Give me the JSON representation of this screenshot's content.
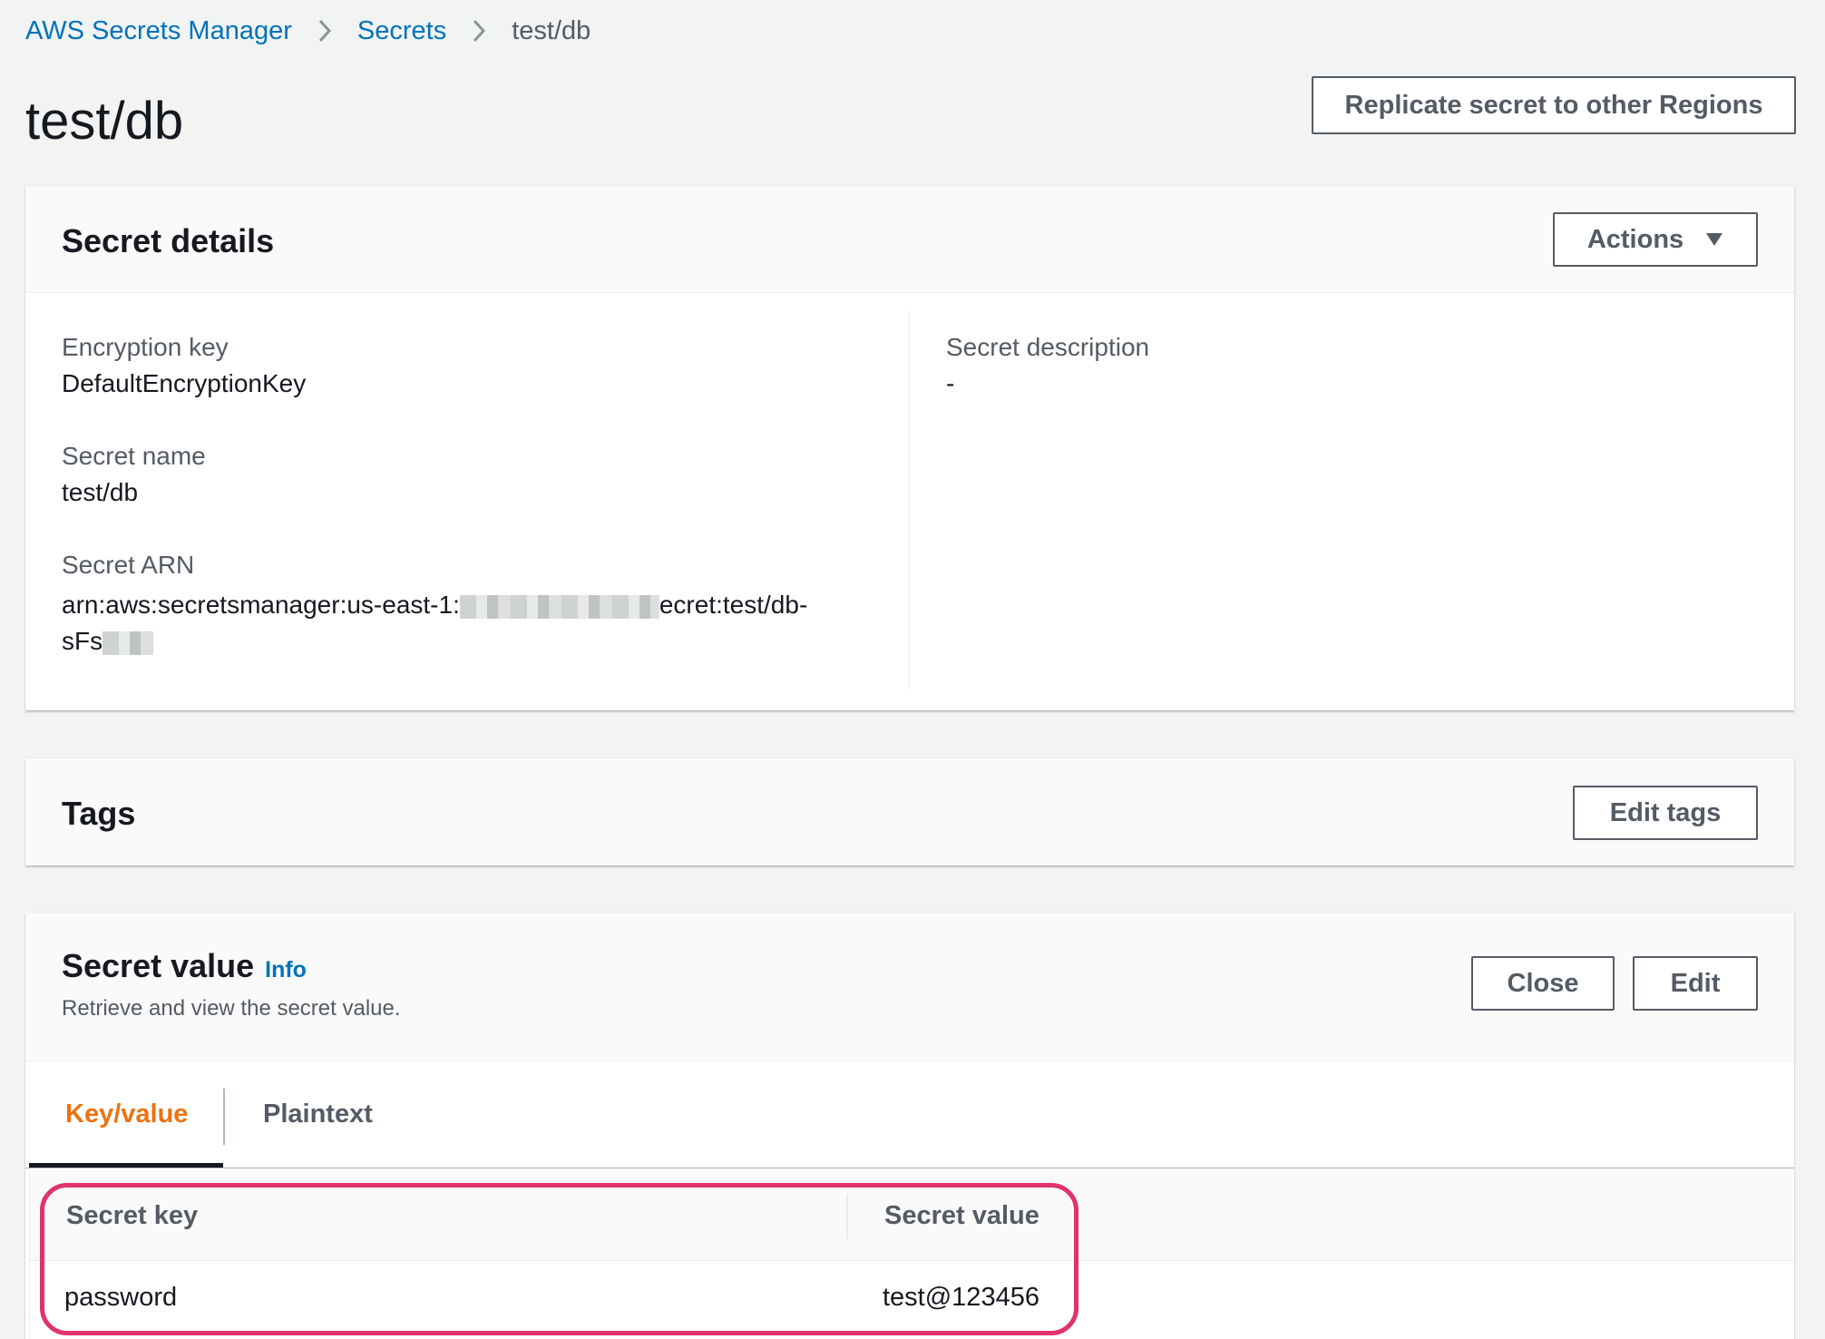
{
  "breadcrumb": {
    "items": [
      "AWS Secrets Manager",
      "Secrets"
    ],
    "current": "test/db"
  },
  "page": {
    "title": "test/db",
    "replicate_button": "Replicate secret to other Regions"
  },
  "secret_details": {
    "title": "Secret details",
    "actions_button": "Actions",
    "encryption_key_label": "Encryption key",
    "encryption_key_value": "DefaultEncryptionKey",
    "secret_name_label": "Secret name",
    "secret_name_value": "test/db",
    "arn_label": "Secret ARN",
    "arn_prefix": "arn:aws:secretsmanager:us-east-1:",
    "arn_suffix": "ecret:test/db-",
    "arn_line2": "sFs",
    "description_label": "Secret description",
    "description_value": "-"
  },
  "tags": {
    "title": "Tags",
    "edit_button": "Edit tags"
  },
  "secret_value": {
    "title": "Secret value",
    "info_link": "Info",
    "subtitle": "Retrieve and view the secret value.",
    "close_button": "Close",
    "edit_button": "Edit",
    "tabs": [
      {
        "label": "Key/value",
        "active": true
      },
      {
        "label": "Plaintext",
        "active": false
      }
    ],
    "columns": [
      "Secret key",
      "Secret value"
    ],
    "rows": [
      {
        "key": "password",
        "value": "test@123456"
      }
    ]
  },
  "colors": {
    "link": "#0073bb",
    "active_tab": "#ec7211",
    "highlight": "#e0336b",
    "background": "#f2f3f3"
  }
}
